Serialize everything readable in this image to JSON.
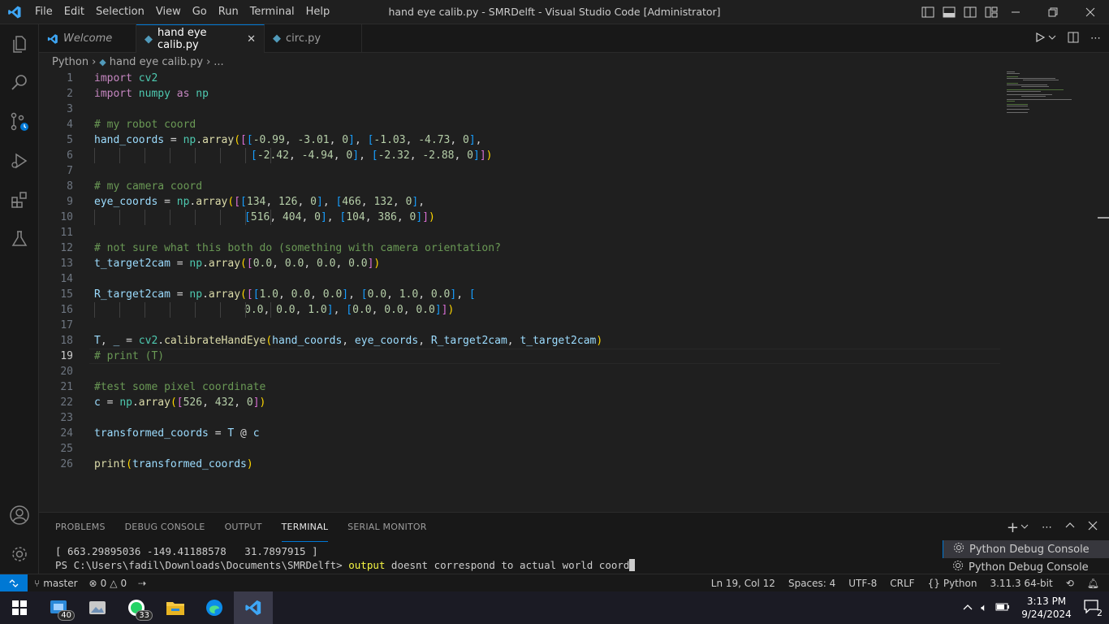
{
  "window": {
    "title": "hand eye calib.py - SMRDelft - Visual Studio Code [Administrator]"
  },
  "menu": [
    "File",
    "Edit",
    "Selection",
    "View",
    "Go",
    "Run",
    "Terminal",
    "Help"
  ],
  "tabs": [
    {
      "label": "Welcome",
      "active": false
    },
    {
      "label": "hand eye calib.py",
      "active": true
    },
    {
      "label": "circ.py",
      "active": false
    }
  ],
  "breadcrumb": {
    "root": "Python",
    "file": "hand eye calib.py",
    "more": "..."
  },
  "editor": {
    "current_line": 19,
    "line_numbers": [
      "1",
      "2",
      "3",
      "4",
      "5",
      "6",
      "7",
      "8",
      "9",
      "10",
      "11",
      "12",
      "13",
      "14",
      "15",
      "16",
      "17",
      "18",
      "19",
      "20",
      "21",
      "22",
      "23",
      "24",
      "25",
      "26"
    ]
  },
  "code": {
    "l1_kw": "import",
    "l1_mod": "cv2",
    "l2_kw": "import",
    "l2_mod": "numpy",
    "l2_as": "as",
    "l2_alias": "np",
    "l4": "# my robot coord",
    "l5_var": "hand_coords",
    "l5_eq": " = ",
    "l5_np": "np",
    "l5_fn": "array",
    "l5_n1": "-0.99",
    "l5_n2": "-3.01",
    "l5_n3": "0",
    "l5_n4": "-1.03",
    "l5_n5": "-4.73",
    "l5_n6": "0",
    "l6_n1": "-2.42",
    "l6_n2": "-4.94",
    "l6_n3": "0",
    "l6_n4": "-2.32",
    "l6_n5": "-2.88",
    "l6_n6": "0",
    "l8": "# my camera coord",
    "l9_var": "eye_coords",
    "l9_n1": "134",
    "l9_n2": "126",
    "l9_n3": "0",
    "l9_n4": "466",
    "l9_n5": "132",
    "l9_n6": "0",
    "l10_n1": "516",
    "l10_n2": "404",
    "l10_n3": "0",
    "l10_n4": "104",
    "l10_n5": "386",
    "l10_n6": "0",
    "l12": "# not sure what this both do (something with camera orientation?",
    "l13_var": "t_target2cam",
    "l13_n1": "0.0",
    "l13_n2": "0.0",
    "l13_n3": "0.0",
    "l13_n4": "0.0",
    "l15_var": "R_target2cam",
    "l15_n1": "1.0",
    "l15_n2": "0.0",
    "l15_n3": "0.0",
    "l15_n4": "0.0",
    "l15_n5": "1.0",
    "l15_n6": "0.0",
    "l16_n1": "0.0",
    "l16_n2": "0.0",
    "l16_n3": "1.0",
    "l16_n4": "0.0",
    "l16_n5": "0.0",
    "l16_n6": "0.0",
    "l18_t": "T",
    "l18_u": "_",
    "l18_mod": "cv2",
    "l18_fn": "calibrateHandEye",
    "l18_a1": "hand_coords",
    "l18_a2": "eye_coords",
    "l18_a3": "R_target2cam",
    "l18_a4": "t_target2cam",
    "l19": "# print (T)",
    "l21": "#test some pixel coordinate",
    "l22_var": "c",
    "l22_n1": "526",
    "l22_n2": "432",
    "l22_n3": "0",
    "l24_var": "transformed_coords",
    "l24_t": "T",
    "l24_op": "@",
    "l24_c": "c",
    "l26_fn": "print",
    "l26_arg": "transformed_coords"
  },
  "panel": {
    "tabs": [
      "PROBLEMS",
      "DEBUG CONSOLE",
      "OUTPUT",
      "TERMINAL",
      "SERIAL MONITOR"
    ],
    "active_tab": "TERMINAL",
    "terminal_output": "[ 663.29895036 -149.41188578   31.7897915 ]",
    "prompt": "PS C:\\Users\\fadil\\Downloads\\Documents\\SMRDelft>",
    "command": "output",
    "command_rest": " doesnt correspond to actual world coord",
    "terminal_list": [
      "Python Debug Console",
      "Python Debug Console"
    ]
  },
  "statusbar": {
    "branch": "master",
    "errors": "0",
    "warnings": "0",
    "position": "Ln 19, Col 12",
    "spaces": "Spaces: 4",
    "encoding": "UTF-8",
    "eol": "CRLF",
    "language": "Python",
    "interpreter": "3.11.3 64-bit"
  },
  "taskbar": {
    "badge_task": "40",
    "badge_whatsapp": "33",
    "time": "3:13 PM",
    "date": "9/24/2024",
    "notifications": "2"
  },
  "colors": {
    "accent": "#0078d4",
    "editor_bg": "#1f1f1f",
    "comment": "#6a9955",
    "keyword": "#c586c0"
  }
}
